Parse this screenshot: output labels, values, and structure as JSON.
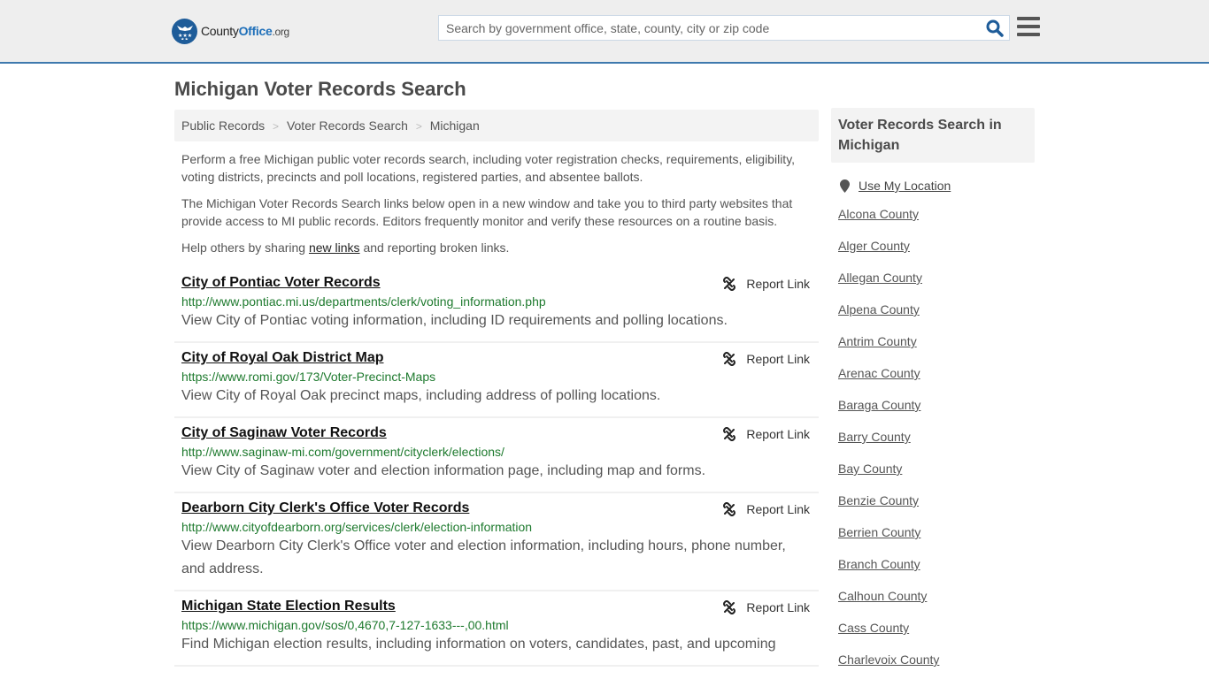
{
  "header": {
    "logo": {
      "county": "County",
      "office": "Office",
      "org": ".org"
    },
    "search_placeholder": "Search by government office, state, county, city or zip code",
    "search_icon": "search-icon",
    "menu_icon": "hamburger-menu-icon"
  },
  "page_title": "Michigan Voter Records Search",
  "breadcrumb": [
    {
      "label": "Public Records"
    },
    {
      "label": "Voter Records Search"
    },
    {
      "label": "Michigan"
    }
  ],
  "breadcrumb_separator": ">",
  "intro": {
    "p1": "Perform a free Michigan public voter records search, including voter registration checks, requirements, eligibility, voting districts, precincts and poll locations, registered parties, and absentee ballots.",
    "p2": "The Michigan Voter Records Search links below open in a new window and take you to third party websites that provide access to MI public records. Editors frequently monitor and verify these resources on a routine basis.",
    "p3_before": "Help others by sharing ",
    "p3_link": "new links",
    "p3_after": " and reporting broken links."
  },
  "report_label": "Report Link",
  "results": [
    {
      "title": "City of Pontiac Voter Records",
      "url": "http://www.pontiac.mi.us/departments/clerk/voting_information.php",
      "desc": "View City of Pontiac voting information, including ID requirements and polling locations."
    },
    {
      "title": "City of Royal Oak District Map",
      "url": "https://www.romi.gov/173/Voter-Precinct-Maps",
      "desc": "View City of Royal Oak precinct maps, including address of polling locations."
    },
    {
      "title": "City of Saginaw Voter Records",
      "url": "http://www.saginaw-mi.com/government/cityclerk/elections/",
      "desc": "View City of Saginaw voter and election information page, including map and forms."
    },
    {
      "title": "Dearborn City Clerk's Office Voter Records",
      "url": "http://www.cityofdearborn.org/services/clerk/election-information",
      "desc": "View Dearborn City Clerk's Office voter and election information, including hours, phone number, and address."
    },
    {
      "title": "Michigan State Election Results",
      "url": "https://www.michigan.gov/sos/0,4670,7-127-1633---,00.html",
      "desc": "Find Michigan election results, including information on voters, candidates, past, and upcoming"
    }
  ],
  "sidebar": {
    "heading": "Voter Records Search in Michigan",
    "use_location": "Use My Location",
    "counties": [
      "Alcona County",
      "Alger County",
      "Allegan County",
      "Alpena County",
      "Antrim County",
      "Arenac County",
      "Baraga County",
      "Barry County",
      "Bay County",
      "Benzie County",
      "Berrien County",
      "Branch County",
      "Calhoun County",
      "Cass County",
      "Charlevoix County"
    ]
  },
  "colors": {
    "brand_blue": "#1e5c99",
    "header_border": "#3e79ad",
    "url_green": "#1e7a2e"
  }
}
